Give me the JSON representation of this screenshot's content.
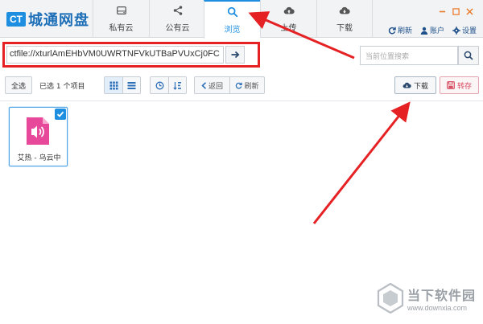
{
  "app": {
    "logo_badge": "CT",
    "logo_text": "城通网盘"
  },
  "tabs": [
    {
      "label": "私有云",
      "icon": "drive-icon"
    },
    {
      "label": "公有云",
      "icon": "share-icon"
    },
    {
      "label": "浏览",
      "icon": "search-icon",
      "active": true
    },
    {
      "label": "上传",
      "icon": "cloud-upload-icon"
    },
    {
      "label": "下载",
      "icon": "cloud-download-icon"
    }
  ],
  "top_actions": {
    "refresh": "刷新",
    "account": "账户",
    "settings": "设置"
  },
  "address": {
    "value": "ctfile://xturlAmEHbVM0UWRTNFVkUTBaPVUxCj0FC"
  },
  "search": {
    "placeholder": "当前位置搜索"
  },
  "toolbar": {
    "select_all": "全选",
    "selected_text": "已选 1 个项目",
    "back": "返回",
    "refresh": "刷新",
    "download": "下载",
    "save": "转存"
  },
  "file": {
    "name": "艾热 - 乌云中",
    "selected": true
  },
  "watermark": {
    "name": "当下软件园",
    "url": "www.downxia.com"
  },
  "colors": {
    "accent": "#1e8fe0",
    "annotation": "#e52124",
    "audio_icon": "#e8489a"
  }
}
